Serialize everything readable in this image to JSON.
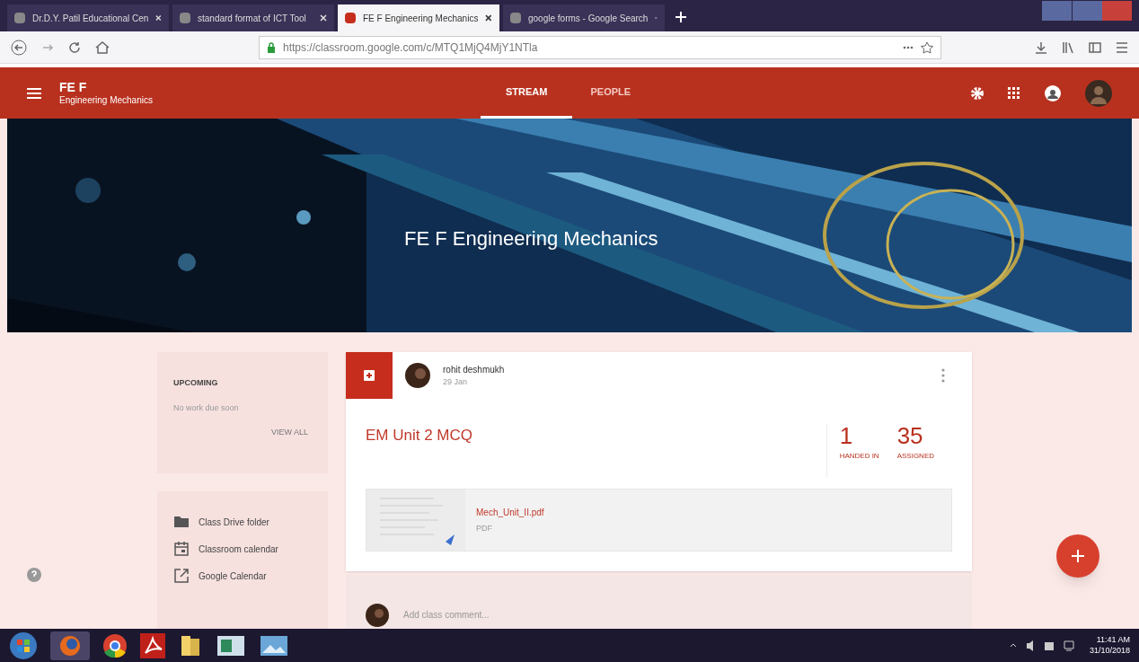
{
  "browser_tabs": [
    {
      "title": "Dr.D.Y. Patil Educational Cen",
      "selected": false
    },
    {
      "title": "standard format of ICT Tool",
      "selected": false
    },
    {
      "title": "FE F Engineering Mechanics",
      "selected": true
    },
    {
      "title": "google forms - Google Search",
      "selected": false
    }
  ],
  "address_bar": {
    "url": "https://classroom.google.com/c/MTQ1MjQ4MjY1NTla"
  },
  "class_header": {
    "name": "FE F",
    "subject": "Engineering Mechanics",
    "tabs": [
      {
        "label": "STREAM",
        "selected": true
      },
      {
        "label": "PEOPLE",
        "selected": false
      }
    ]
  },
  "banner": {
    "title": "FE F Engineering Mechanics"
  },
  "upcoming": {
    "title": "UPCOMING",
    "message": "No work due soon",
    "link": "VIEW ALL"
  },
  "class_links": [
    {
      "kind": "folder",
      "label": "Class Drive folder"
    },
    {
      "kind": "calendar",
      "label": "Classroom calendar"
    },
    {
      "kind": "external",
      "label": "Google Calendar"
    }
  ],
  "post": {
    "author": "rohit deshmukh",
    "date": "29 Jan",
    "title": "EM Unit 2 MCQ",
    "stats": [
      {
        "value": "1",
        "label": "HANDED IN"
      },
      {
        "value": "35",
        "label": "ASSIGNED"
      }
    ],
    "attachment": {
      "name": "Mech_Unit_II.pdf",
      "type": "PDF"
    },
    "comment_placeholder": "Add class comment..."
  },
  "taskbar": {
    "time": "11:41 AM",
    "date": "31/10/2018"
  }
}
